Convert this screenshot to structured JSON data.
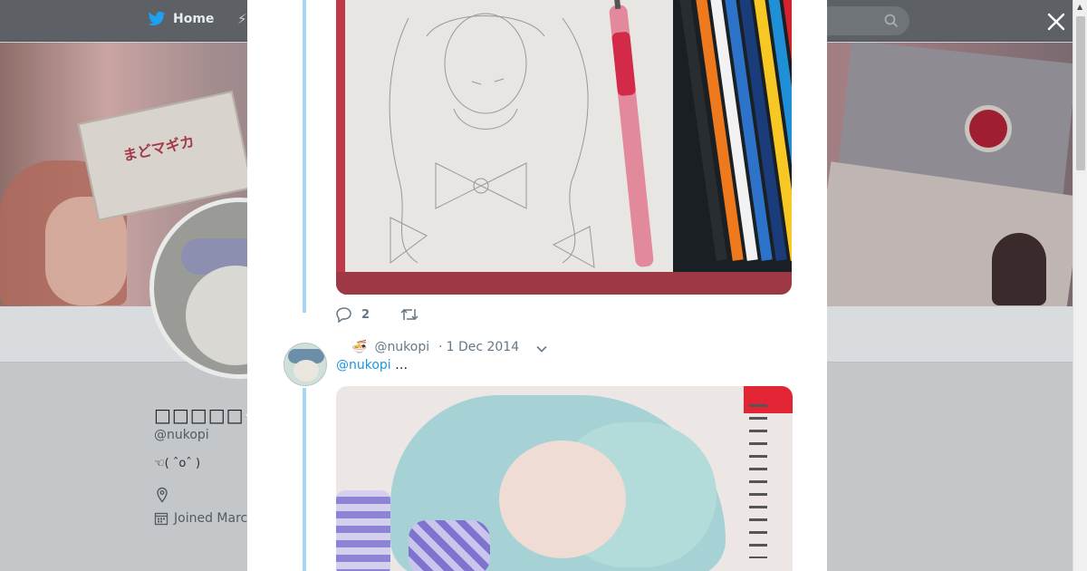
{
  "nav": {
    "home_label": "Home",
    "moments_glyph": "⚡",
    "icons": [
      "twitter-bird-icon",
      "lightning-icon",
      "search-icon"
    ]
  },
  "banner": {
    "card_text": "まどマギカ"
  },
  "profile": {
    "name": "□□□□□🍜",
    "handle": "@nukopi",
    "bio": "☜( ˆoˆ )",
    "joined": "Joined Marc"
  },
  "modal": {
    "tweet1": {
      "reply_count": "2",
      "retweet_count": ""
    },
    "tweet2": {
      "ramen": "🍜",
      "handle": "@nukopi",
      "separator": "·",
      "date": "1 Dec 2014",
      "mention": "@nukopi",
      "ellipsis": "…"
    }
  },
  "colors": {
    "link": "#1b95e0",
    "thread_line": "#a5d8f5",
    "action_gray": "#657786"
  }
}
